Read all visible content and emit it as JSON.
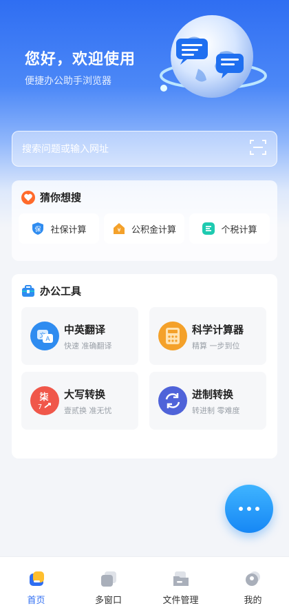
{
  "header": {
    "greeting": "您好，欢迎使用",
    "subtitle": "便捷办公助手浏览器"
  },
  "search": {
    "placeholder": "搜索问题或输入网址",
    "scan_icon": "scan-icon"
  },
  "guess": {
    "title": "猜你想搜",
    "items": [
      {
        "label": "社保计算",
        "icon": "shield-icon"
      },
      {
        "label": "公积金计算",
        "icon": "house-icon"
      },
      {
        "label": "个税计算",
        "icon": "tax-icon"
      }
    ]
  },
  "tools": {
    "title": "办公工具",
    "items": [
      {
        "name": "中英翻译",
        "desc": "快速 准确翻译",
        "icon": "translate-icon",
        "color": "#2f8cf0"
      },
      {
        "name": "科学计算器",
        "desc": "精算 一步到位",
        "icon": "calculator-icon",
        "color": "#f4a12a"
      },
      {
        "name": "大写转换",
        "desc": "壹贰换 准无忧",
        "icon": "uppercase-icon",
        "color": "#f0574a"
      },
      {
        "name": "进制转换",
        "desc": "转进制 零难度",
        "icon": "convert-icon",
        "color": "#4f63d9"
      }
    ]
  },
  "tabbar": {
    "items": [
      {
        "label": "首页",
        "icon": "home-icon",
        "active": true
      },
      {
        "label": "多窗口",
        "icon": "windows-icon",
        "active": false
      },
      {
        "label": "文件管理",
        "icon": "folder-icon",
        "active": false
      },
      {
        "label": "我的",
        "icon": "user-icon",
        "active": false
      }
    ]
  },
  "colors": {
    "accent": "#2f6ef2",
    "fab": "#1687f5"
  }
}
